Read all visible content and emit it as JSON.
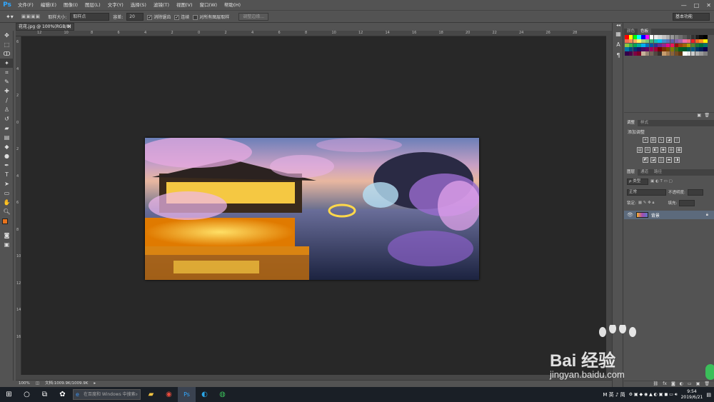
{
  "menubar": {
    "logo": "Ps",
    "items": [
      "文件(F)",
      "编辑(E)",
      "图像(I)",
      "图层(L)",
      "文字(Y)",
      "选择(S)",
      "滤镜(T)",
      "视图(V)",
      "窗口(W)",
      "帮助(H)"
    ],
    "minimize": "—",
    "maximize": "□",
    "close": "✕"
  },
  "options": {
    "sample_size_label": "取样大小:",
    "sample_size_value": "取样点",
    "tolerance_label": "容差:",
    "tolerance_value": "20",
    "antialias_label": "消除锯齿",
    "contiguous_label": "连续",
    "sample_all_label": "对所有图层取样",
    "refine_edge_button": "调整边缘...",
    "workspace": "基本功能"
  },
  "document": {
    "tab_title": "花花.jpg @ 100%(RGB/8)",
    "zoom": "100%",
    "doc_size": "文档:1009.9K/1009.9K"
  },
  "rulers": {
    "top_ticks": [
      "12",
      "10",
      "8",
      "6",
      "4",
      "2",
      "0",
      "2",
      "4",
      "6",
      "8",
      "10",
      "12",
      "14",
      "16",
      "18",
      "20",
      "22",
      "24",
      "26",
      "28"
    ],
    "left_ticks": [
      "6",
      "4",
      "2",
      "0",
      "2",
      "4",
      "6",
      "8",
      "10",
      "12",
      "14",
      "16"
    ]
  },
  "panels": {
    "swatch_tabs": [
      "颜色",
      "色板"
    ],
    "adjust_tabs": [
      "调整",
      "样式"
    ],
    "adjust_title": "添加调整",
    "layers_tabs": [
      "图层",
      "通道",
      "路径"
    ],
    "kind_filter": "ρ 类型",
    "blend_mode": "正常",
    "opacity_label": "不透明度:",
    "lock_label": "锁定:",
    "fill_label": "填充:",
    "layer_name": "背景",
    "swatch_colors": [
      "#ff0000",
      "#ffff00",
      "#00ff00",
      "#00ffff",
      "#0000ff",
      "#ff00ff",
      "#ffffff",
      "#ebebeb",
      "#d6d6d6",
      "#c2c2c2",
      "#adadad",
      "#999999",
      "#858585",
      "#707070",
      "#5c5c5c",
      "#474747",
      "#333333",
      "#1f1f1f",
      "#0a0a0a",
      "#000000",
      "#f26c4f",
      "#f68e55",
      "#fbaf5c",
      "#fff467",
      "#acd372",
      "#7cc576",
      "#3bb878",
      "#1abbb4",
      "#00bff3",
      "#438cca",
      "#5574b9",
      "#605ca8",
      "#855fa8",
      "#a763a8",
      "#f06eaa",
      "#f26d7d",
      "#ed1c24",
      "#f26522",
      "#f7941d",
      "#fff200",
      "#8dc63f",
      "#39b54a",
      "#00a651",
      "#00a99d",
      "#00aeef",
      "#0072bc",
      "#0054a6",
      "#2e3192",
      "#662d91",
      "#92278f",
      "#ec008c",
      "#ed145b",
      "#9e0b0f",
      "#a0410d",
      "#a36209",
      "#aba000",
      "#598527",
      "#1a7b30",
      "#007236",
      "#00746b",
      "#0076a3",
      "#004b80",
      "#003471",
      "#1b1464",
      "#440e62",
      "#630460",
      "#9e005d",
      "#9e0039",
      "#790000",
      "#7b2e00",
      "#7d4900",
      "#827b00",
      "#406618",
      "#005e20",
      "#005826",
      "#005952",
      "#005b7f",
      "#003663",
      "#002157",
      "#0d004c",
      "#32004b",
      "#4b0049",
      "#7b0046",
      "#7a0026",
      "#c7b299",
      "#998675",
      "#736357",
      "#534741",
      "#37302d",
      "#c69c6d",
      "#a67c52",
      "#8c6239",
      "#754c24",
      "#603913",
      "#ffffff",
      "#e6e6e6",
      "#cccccc",
      "#b3b3b3",
      "#999999",
      "#808080"
    ],
    "foreground_color": "#e8731c",
    "background_color": "#ffffff"
  },
  "taskbar": {
    "search_placeholder": "在百度和 Windows 中搜索",
    "tray_ime": "M 英 ♪ 简",
    "time": "9:54",
    "date": "2019/6/21"
  },
  "watermark": {
    "text": "Bai 经验",
    "url": "jingyan.baidu.com"
  }
}
